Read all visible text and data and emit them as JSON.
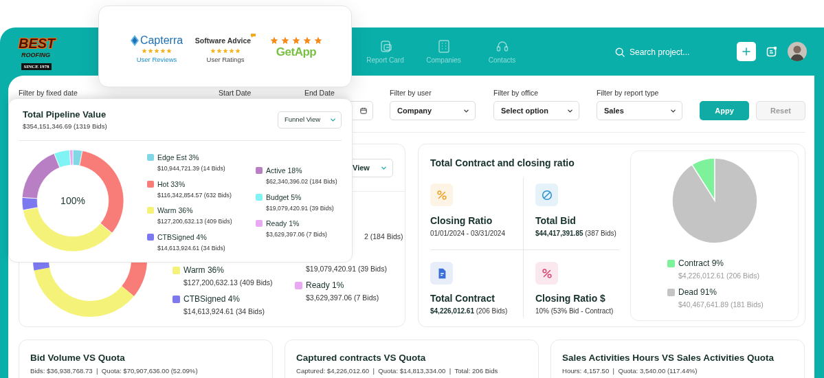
{
  "header": {
    "logo": {
      "line_1": "BEST",
      "line_2": "ROOFING",
      "line_3": "SINCE 1978"
    },
    "nav": [
      {
        "label": "Report Card"
      },
      {
        "label": "Companies"
      },
      {
        "label": "Contacts"
      }
    ],
    "search": {
      "placeholder": "Search project..."
    }
  },
  "filters": [
    {
      "kind": "label",
      "label": "Filter by fixed date"
    },
    {
      "kind": "label",
      "label": "Start Date"
    },
    {
      "kind": "date",
      "label": "End Date"
    },
    {
      "kind": "select",
      "label": "Filter by user",
      "value": "Company"
    },
    {
      "kind": "select",
      "label": "Filter by office",
      "value": "Select option"
    },
    {
      "kind": "select",
      "label": "Filter by report type",
      "value": "Sales"
    }
  ],
  "buttons": [
    {
      "label": "Appy",
      "disabled": false
    },
    {
      "label": "Reset",
      "disabled": true
    }
  ],
  "pipeline_card": {
    "view_select": "View",
    "legend_column_1": [
      {
        "label": "Warm 36%",
        "value": "$127,200,632.13 (409 Bids)",
        "color": "#f5f27a"
      },
      {
        "label": "CTBSigned 4%",
        "value": "$14,613,924.61 (34 Bids)",
        "color": "#7b78f0"
      }
    ],
    "legend_column_2": [
      {
        "kind": "tail",
        "value": "2 (184 Bids)"
      },
      {
        "kind": "value",
        "value": "$19,079,420.91 (39 Bids)"
      },
      {
        "kind": "entry",
        "label": "Ready 1%",
        "value": "$3,629,397.06 (7 Bids)",
        "color": "#e9a8f2"
      }
    ]
  },
  "contract_card": {
    "title": "Total Contract and closing ratio",
    "metrics": [
      {
        "label": "Closing Ratio",
        "value": "01/01/2024 - 03/31/2024",
        "color": "#f0a028"
      },
      {
        "label": "Total Bid",
        "value": "**$44,417,391.85** (387 Bids)",
        "color": "#2a8fd0"
      },
      {
        "label": "Total Contract",
        "value": "**$4,226,012.61** (206 Bids)",
        "color": "#3a6fd8"
      },
      {
        "label": "Closing Ratio $",
        "value": "10% (53% Bid - Contract)",
        "color": "#d8436f"
      }
    ],
    "legend": [
      {
        "label": "Contract 9%",
        "value": "$4,226,012.61 (206 Bids)",
        "color": "#7ef29a"
      },
      {
        "label": "Dead 91%",
        "value": "$40,467,641.89 (181 Bids)",
        "color": "#c4c4c4"
      }
    ],
    "chart_data": {
      "type": "pie",
      "values": [
        9,
        91
      ]
    }
  },
  "bottom_cards": [
    {
      "title": "Bid Volume VS Quota",
      "summary": "Bids: $36,938,768.73  |  Quota: $70,907,636.00 (52.09%)"
    },
    {
      "title": "Captured contracts VS Quota",
      "summary": "Captured: $4,226,012.60  |  Quota: $14,813,334.00  |  Total: 206 Bids"
    },
    {
      "title": "Sales Activities Hours VS Sales Activities Quota",
      "summary": "Hours: 4,157.50  |  Quota: 3,540.00 (117.44%)"
    }
  ],
  "ratings_popup": {
    "reviews": [
      {
        "kind": "stacked",
        "brand": "Capterra",
        "stars": 5,
        "caption": "User Reviews"
      },
      {
        "kind": "stacked",
        "brand": "Software Advice",
        "stars": 5,
        "caption": "User Ratings"
      },
      {
        "kind": "stars_first",
        "brand": "GetApp",
        "stars": 5
      }
    ]
  },
  "pipeline_popup": {
    "title": "Total Pipeline Value",
    "total": "$354,151,346.69 (1319 Bids)",
    "view_select": "Funnel View",
    "center_label": "100%",
    "legend_column_1": [
      {
        "label": "Edge Est 3%",
        "value": "$10,944,721.39 (14 Bids)",
        "color": "#80d8e4"
      },
      {
        "label": "Hot 33%",
        "value": "$116,342,854.57 (632 Bids)",
        "color": "#f87c78"
      },
      {
        "label": "Warm 36%",
        "value": "$127,200,632.13 (409 Bids)",
        "color": "#f5f27a"
      },
      {
        "label": "CTBSigned 4%",
        "value": "$14,613,924.61 (34 Bids)",
        "color": "#7b78f0"
      }
    ],
    "legend_column_2": [
      {
        "label": "Active 18%",
        "value": "$62,340,396.02 (184 Bids)",
        "color": "#b97fc4"
      },
      {
        "label": "Budget 5%",
        "value": "$19,079,420.91 (39 Bids)",
        "color": "#80f4f4"
      },
      {
        "label": "Ready 1%",
        "value": "$3,629,397.06 (7 Bids)",
        "color": "#e9a8f2"
      }
    ],
    "chart_data": {
      "type": "donut",
      "values": [
        3,
        33,
        36,
        4,
        18,
        5,
        1
      ]
    }
  }
}
